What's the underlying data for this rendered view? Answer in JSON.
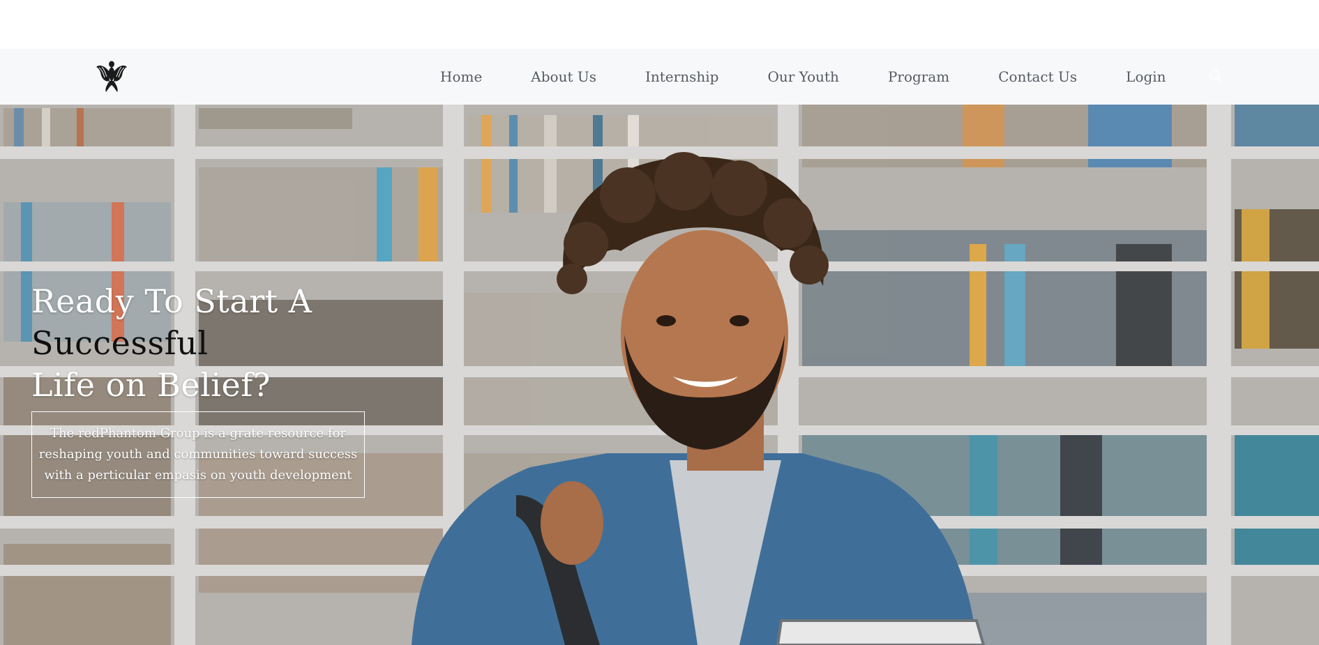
{
  "nav": {
    "items": [
      {
        "label": "Home"
      },
      {
        "label": "About Us"
      },
      {
        "label": "Internship"
      },
      {
        "label": "Our Youth"
      },
      {
        "label": "Program"
      },
      {
        "label": "Contact Us"
      },
      {
        "label": "Login"
      }
    ],
    "logo_icon": "phoenix-logo-icon",
    "search_icon": "search-icon"
  },
  "hero": {
    "title_line1": "Ready To Start A",
    "title_line2": "Successful",
    "title_line3": "Life on Belief?",
    "tagline_line1": "The redPhantom Group is a grate resource for",
    "tagline_line2": "reshaping youth and communities toward success",
    "tagline_line3": "with a perticular empasis on youth development",
    "background_image": "smiling young man with curly hair holding books in front of library bookshelves"
  },
  "colors": {
    "nav_background": "#f7f8fa",
    "nav_text": "#555a61",
    "hero_title_light": "#ffffff",
    "hero_title_dark": "#0f0f0f"
  }
}
